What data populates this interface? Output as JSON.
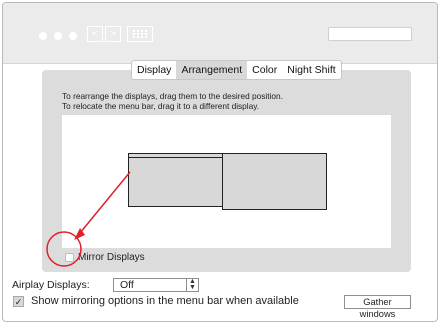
{
  "window": {
    "nav_back": "<",
    "nav_forward": ">"
  },
  "tabs": [
    {
      "label": "Display",
      "selected": false
    },
    {
      "label": "Arrangement",
      "selected": true
    },
    {
      "label": "Color",
      "selected": false
    },
    {
      "label": "Night Shift",
      "selected": false
    }
  ],
  "instructions": {
    "line1": "To rearrange the displays, drag them to the desired position.",
    "line2": "To relocate the menu bar, drag it to a different display."
  },
  "mirror": {
    "label": "Mirror Displays",
    "checked": false
  },
  "airplay": {
    "label": "Airplay Displays:",
    "value": "Off"
  },
  "show_mirroring": {
    "label": "Show mirroring options in the menu bar when available",
    "checked": true
  },
  "gather_button": "Gather windows",
  "annotation": {
    "color": "#e0202a"
  }
}
